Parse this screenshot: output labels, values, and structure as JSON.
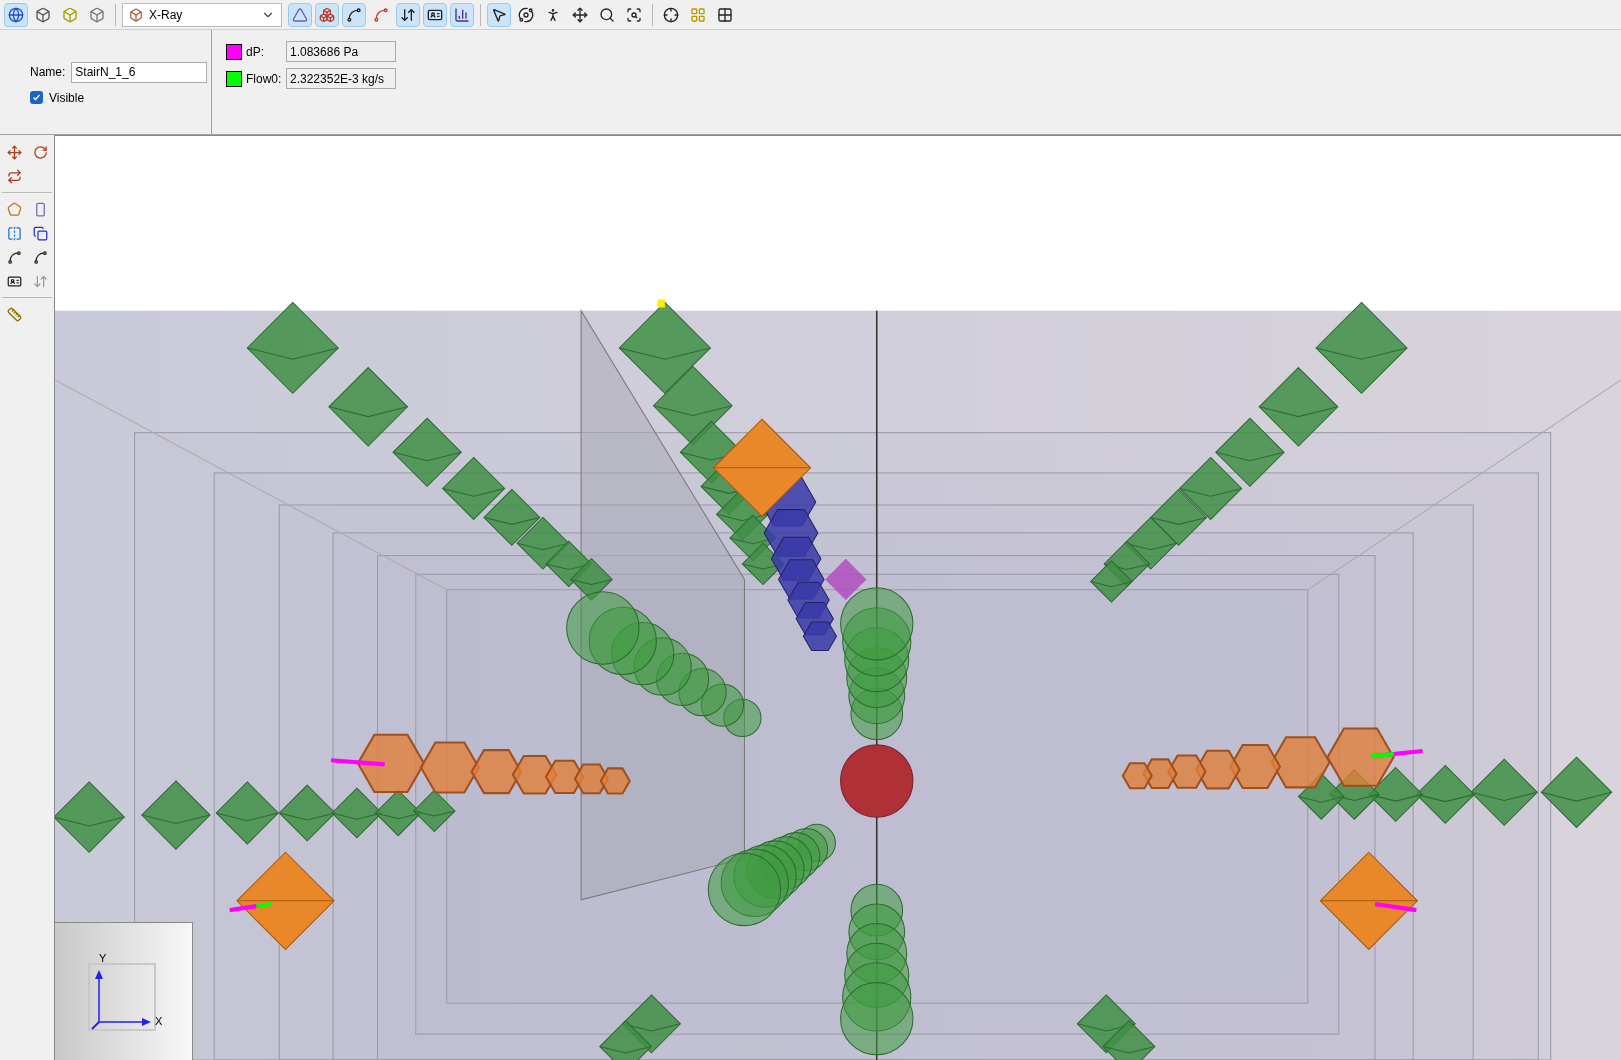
{
  "toolbar": {
    "groups": [
      [
        {
          "selected": true
        },
        {
          "selected": false
        },
        {
          "selected": false
        },
        {
          "selected": false
        }
      ],
      [
        {
          "selected": true
        },
        {
          "selected": true
        },
        {
          "selected": true
        },
        {
          "selected": false
        },
        {
          "selected": true
        },
        {
          "selected": true
        },
        {
          "selected": true
        }
      ],
      [
        {
          "selected": true
        },
        {
          "selected": false
        },
        {
          "selected": false
        },
        {
          "selected": false
        },
        {
          "selected": false
        },
        {
          "selected": false
        }
      ],
      [
        {
          "selected": false
        },
        {
          "selected": false
        },
        {
          "selected": false
        }
      ]
    ],
    "view_mode": "X-Ray"
  },
  "properties": {
    "name_label": "Name:",
    "name_value": "StairN_1_6",
    "visible": {
      "label": "Visible",
      "checked": true
    }
  },
  "legend": [
    {
      "label": "dP:",
      "color": "#ff00ff",
      "value": "1.083686 Pa"
    },
    {
      "label": "Flow0:",
      "color": "#00ff00",
      "value": "2.322352E-3 kg/s"
    }
  ],
  "axes": {
    "y_label": "Y",
    "x_label": "X"
  }
}
